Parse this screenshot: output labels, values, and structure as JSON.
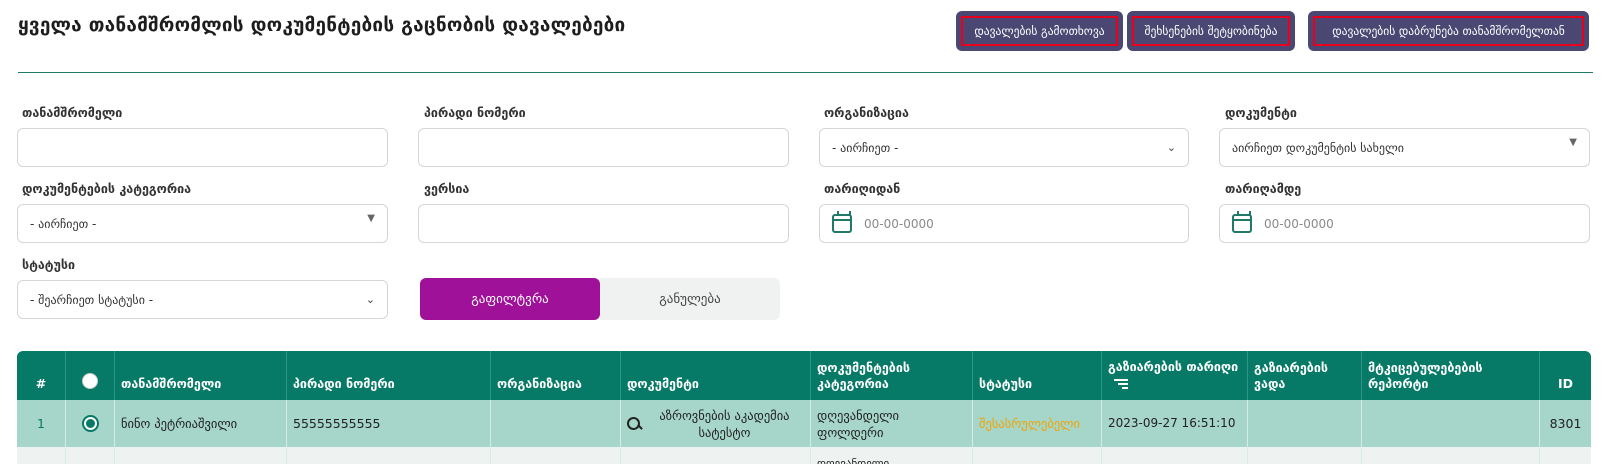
{
  "page": {
    "title": "ყველა თანამშრომლის დოკუმენტების გაცნობის დავალებები"
  },
  "actions": {
    "recall": "დავალების გამოთხოვა",
    "remind": "შეხსენების შეტყობინება",
    "return": "დავალების დაბრუნება თანამშრომელთან"
  },
  "filters": {
    "employee_label": "თანამშრომელი",
    "employee_value": "",
    "personal_number_label": "პირადი ნომერი",
    "personal_number_value": "",
    "organization_label": "ორგანიზაცია",
    "organization_value": "- აირჩიეთ -",
    "document_label": "დოკუმენტი",
    "document_value": "აირჩიეთ დოკუმენტის სახელი",
    "category_label": "დოკუმენტების კატეგორია",
    "category_value": "- აირჩიეთ -",
    "version_label": "ვერსია",
    "version_value": "",
    "date_from_label": "თარიღიდან",
    "date_from_placeholder": "00-00-0000",
    "date_to_label": "თარიღამდე",
    "date_to_placeholder": "00-00-0000",
    "status_label": "სტატუსი",
    "status_value": "- შეარჩიეთ სტატუსი -",
    "filter_button": "გაფილტვრა",
    "reset_button": "განულება"
  },
  "table": {
    "columns": {
      "num": "#",
      "employee": "თანამშრომელი",
      "personal_number": "პირადი ნომერი",
      "organization": "ორგანიზაცია",
      "document": "დოკუმენტი",
      "category": "დოკუმენტების კატეგორია",
      "status": "სტატუსი",
      "shared_date": "გაზიარების თარიღი",
      "share_deadline": "გაზიარების ვადა",
      "confirmation_report": "მტკიცებულებების რეპორტი",
      "id": "ID"
    },
    "rows": [
      {
        "num": "1",
        "employee": "ნინო პეტრიაშვილი",
        "personal_number": "55555555555",
        "organization": "",
        "document": "აზროვნების აკადემია სატესტო",
        "category": "დღევანდელი ფოლდერი",
        "status": "შესასრულებელი",
        "shared_date": "2023-09-27 16:51:10",
        "share_deadline": "",
        "confirmation_report": "",
        "id": "8301"
      }
    ],
    "partial_row_category": "დღევანდელი"
  },
  "colors": {
    "accent": "#067a66",
    "primary_button": "#a0119a",
    "header_buttons": "#4a4873",
    "status_pending": "#f0a500",
    "selected_row": "#a6d5c9"
  }
}
